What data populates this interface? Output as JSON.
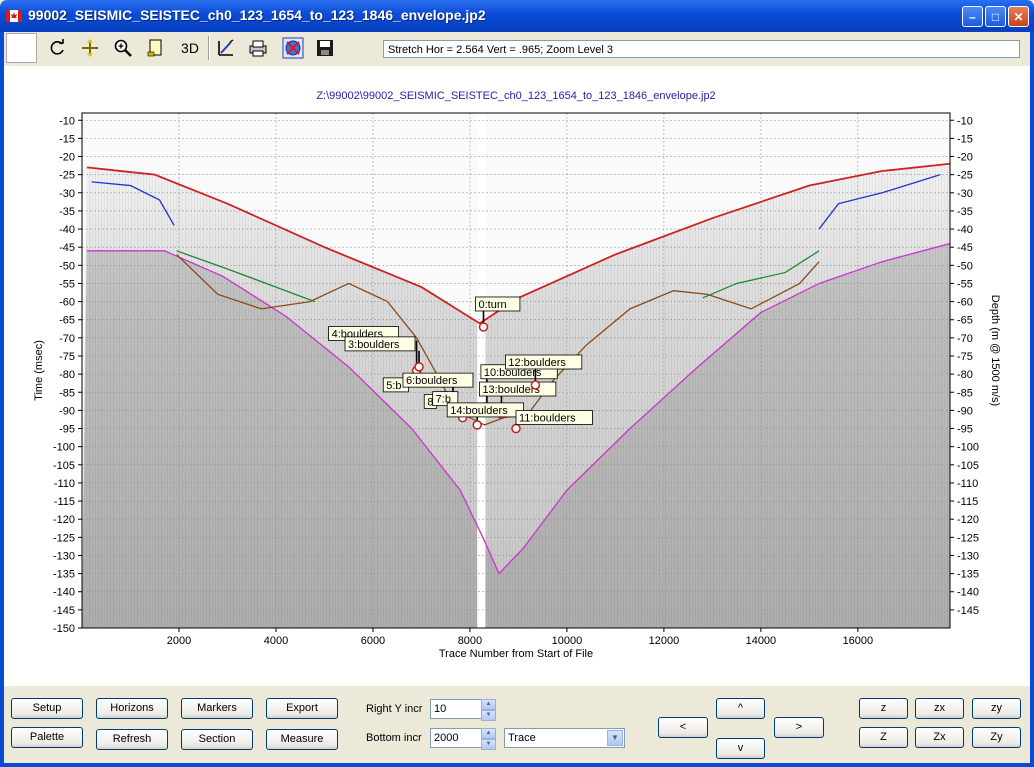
{
  "window": {
    "title": "99002_SEISMIC_SEISTEC_ch0_123_1654_to_123_1846_envelope.jp2"
  },
  "toolbar": {
    "status": "Stretch Hor = 2.564 Vert = .965; Zoom Level 3",
    "tools": [
      "refresh-icon",
      "pan-icon",
      "zoom-icon",
      "page-icon",
      "3D",
      "pick-icon",
      "print-icon",
      "globe-icon",
      "save-icon"
    ],
    "three_d_label": "3D"
  },
  "plot": {
    "file_path": "Z:\\99002\\99002_SEISMIC_SEISTEC_ch0_123_1654_to_123_1846_envelope.jp2",
    "left_axis_label": "Time (msec)",
    "right_axis_label": "Depth (m @ 1500 m/s)",
    "bottom_axis_label": "Trace Number from Start of File",
    "y_ticks": [
      -10,
      -15,
      -20,
      -25,
      -30,
      -35,
      -40,
      -45,
      -50,
      -55,
      -60,
      -65,
      -70,
      -75,
      -80,
      -85,
      -90,
      -95,
      -100,
      -105,
      -110,
      -115,
      -120,
      -125,
      -130,
      -135,
      -140,
      -145,
      -150
    ],
    "right_y_ticks": [
      -10,
      -15,
      -20,
      -25,
      -30,
      -35,
      -40,
      -45,
      -50,
      -55,
      -60,
      -65,
      -70,
      -75,
      -80,
      -85,
      -90,
      -95,
      -100,
      -105,
      -110,
      -115,
      -120,
      -125,
      -130,
      -135,
      -140,
      -145
    ],
    "x_ticks": [
      2000,
      4000,
      6000,
      8000,
      10000,
      12000,
      14000,
      16000
    ],
    "x_range": [
      0,
      17900
    ],
    "y_range": [
      -8,
      -150
    ],
    "colors": {
      "seabed": "#cc2222",
      "blue": "#2233cc",
      "green": "#228833",
      "brown": "#8a4a1a",
      "magenta": "#cc33cc"
    },
    "markers": [
      {
        "label": "0:turn",
        "x": 8280,
        "y": -67
      },
      {
        "label": "4:boulders",
        "x": 6900,
        "y": -79
      },
      {
        "label": "3:boulders",
        "x": 6950,
        "y": -78
      },
      {
        "label": "5:b",
        "x": 7450,
        "y": -86
      },
      {
        "label": "6:boulders",
        "x": 7650,
        "y": -88
      },
      {
        "label": "8",
        "x": 7800,
        "y": -90
      },
      {
        "label": "7:b",
        "x": 7850,
        "y": -92
      },
      {
        "label": "10:boulders",
        "x": 8350,
        "y": -89
      },
      {
        "label": "13:boulders",
        "x": 8650,
        "y": -91
      },
      {
        "label": "14:boulders",
        "x": 8150,
        "y": -94
      },
      {
        "label": "11:boulders",
        "x": 8950,
        "y": -95
      },
      {
        "label": "12:boulders",
        "x": 9350,
        "y": -83
      }
    ],
    "series": {
      "seabed": [
        [
          100,
          -23
        ],
        [
          1500,
          -25
        ],
        [
          3000,
          -33
        ],
        [
          5000,
          -45
        ],
        [
          7000,
          -56
        ],
        [
          8200,
          -66
        ],
        [
          9000,
          -59
        ],
        [
          11000,
          -47
        ],
        [
          13000,
          -37
        ],
        [
          15000,
          -28
        ],
        [
          16500,
          -24
        ],
        [
          17900,
          -22
        ]
      ],
      "blue_left": [
        [
          200,
          -27
        ],
        [
          1000,
          -28
        ],
        [
          1600,
          -32
        ],
        [
          1900,
          -39
        ]
      ],
      "blue_right": [
        [
          15200,
          -40
        ],
        [
          15600,
          -33
        ],
        [
          16500,
          -30
        ],
        [
          17700,
          -25
        ]
      ],
      "green_left": [
        [
          1950,
          -46
        ],
        [
          3000,
          -51
        ],
        [
          4000,
          -56
        ],
        [
          4800,
          -60
        ]
      ],
      "green_right": [
        [
          12800,
          -59
        ],
        [
          13500,
          -55
        ],
        [
          14500,
          -52
        ],
        [
          15200,
          -46
        ]
      ],
      "brown": [
        [
          1950,
          -47
        ],
        [
          2800,
          -58
        ],
        [
          3700,
          -62
        ],
        [
          4700,
          -60
        ],
        [
          5500,
          -55
        ],
        [
          6300,
          -60
        ],
        [
          6900,
          -70
        ],
        [
          7400,
          -82
        ],
        [
          7700,
          -90
        ],
        [
          8300,
          -94
        ],
        [
          8700,
          -92
        ],
        [
          9200,
          -91
        ],
        [
          9700,
          -82
        ],
        [
          10400,
          -72
        ],
        [
          11300,
          -62
        ],
        [
          12200,
          -57
        ],
        [
          12900,
          -58
        ],
        [
          13800,
          -62
        ],
        [
          14800,
          -55
        ],
        [
          15200,
          -49
        ]
      ],
      "magenta": [
        [
          100,
          -46
        ],
        [
          1700,
          -46
        ],
        [
          2900,
          -53
        ],
        [
          4200,
          -64
        ],
        [
          5500,
          -78
        ],
        [
          6800,
          -95
        ],
        [
          7800,
          -112
        ],
        [
          8300,
          -126
        ],
        [
          8600,
          -135
        ],
        [
          9100,
          -128
        ],
        [
          10000,
          -112
        ],
        [
          11300,
          -95
        ],
        [
          12700,
          -78
        ],
        [
          14000,
          -63
        ],
        [
          15200,
          -55
        ],
        [
          16500,
          -49
        ],
        [
          17900,
          -44
        ]
      ]
    }
  },
  "bottom": {
    "buttons": {
      "setup": "Setup",
      "horizons": "Horizons",
      "markers": "Markers",
      "export": "Export",
      "palette": "Palette",
      "refresh": "Refresh",
      "section": "Section",
      "measure": "Measure",
      "up": "^",
      "down": "v",
      "left": "<",
      "right": ">",
      "z": "z",
      "zx": "zx",
      "zy": "zy",
      "Z": "Z",
      "Zx": "Zx",
      "Zy": "Zy"
    },
    "right_y_incr_label": "Right Y incr",
    "right_y_incr_value": "10",
    "bottom_incr_label": "Bottom  incr",
    "bottom_incr_value": "2000",
    "select_value": "Trace"
  }
}
